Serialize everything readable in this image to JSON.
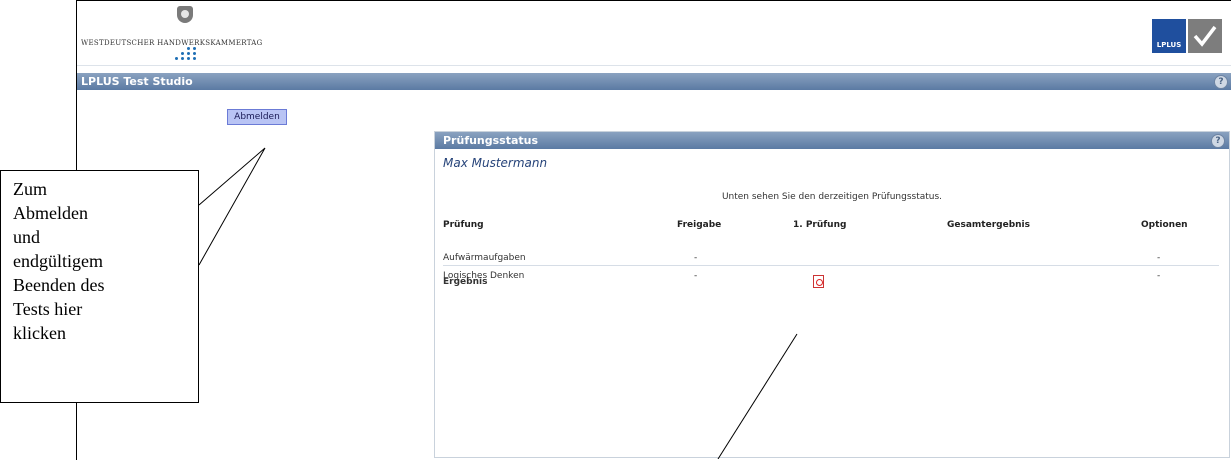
{
  "header": {
    "org_name": "WESTDEUTSCHER HANDWERKSKAMMERTAG",
    "brand_logo_text": "LPLUS"
  },
  "app": {
    "title": "LPLUS Test Studio"
  },
  "sidebar": {
    "logout_label": "Abmelden"
  },
  "panel": {
    "title": "Prüfungsstatus",
    "user_name": "Max Mustermann",
    "info_text": "Unten sehen Sie den derzeitigen Prüfungsstatus.",
    "columns": [
      "Prüfung",
      "Freigabe",
      "1. Prüfung",
      "Gesamtergebnis",
      "Optionen"
    ],
    "rows": [
      {
        "name": "Aufwärmaufgaben",
        "freigabe": "-",
        "first": "",
        "total": "",
        "options": "-"
      },
      {
        "name": "Logisches Denken",
        "freigabe": "-",
        "first": "",
        "total": "",
        "options": "-"
      }
    ],
    "result_label": "Ergebnis",
    "result_icon": "pdf-icon"
  },
  "annotation": {
    "callout_lines": [
      "Zum",
      "Abmelden",
      "und",
      "endgültigem",
      "Beenden des",
      "Tests hier",
      "klicken"
    ]
  },
  "colors": {
    "titlebar": "#5b7aa3",
    "logout_button": "#b9c4f4",
    "user_name": "#27447a",
    "brand_blue": "#1f4f9e"
  }
}
